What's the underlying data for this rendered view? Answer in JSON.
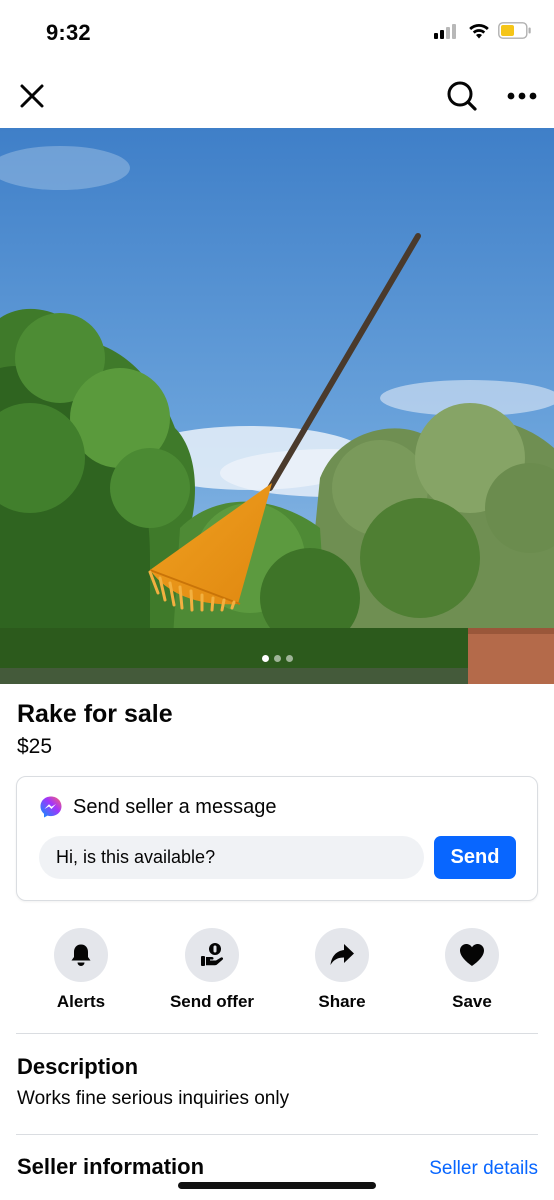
{
  "status_bar": {
    "time": "9:32",
    "battery_color": "#f5c518"
  },
  "nav": {
    "close_icon": "close-icon",
    "search_icon": "search-icon",
    "more_icon": "more-icon"
  },
  "carousel": {
    "count": 3,
    "active_index": 0
  },
  "listing": {
    "title": "Rake for sale",
    "price": "$25"
  },
  "message": {
    "title": "Send seller a message",
    "input_value": "Hi, is this available?",
    "send_label": "Send"
  },
  "actions": [
    {
      "label": "Alerts",
      "icon": "bell-icon"
    },
    {
      "label": "Send offer",
      "icon": "offer-icon"
    },
    {
      "label": "Share",
      "icon": "share-icon"
    },
    {
      "label": "Save",
      "icon": "heart-icon"
    }
  ],
  "description": {
    "title": "Description",
    "text": "Works fine serious inquiries only"
  },
  "seller": {
    "title": "Seller information",
    "details_link": "Seller details"
  },
  "colors": {
    "accent": "#0866ff",
    "action_bg": "#e4e6eb",
    "input_bg": "#f0f2f5"
  }
}
